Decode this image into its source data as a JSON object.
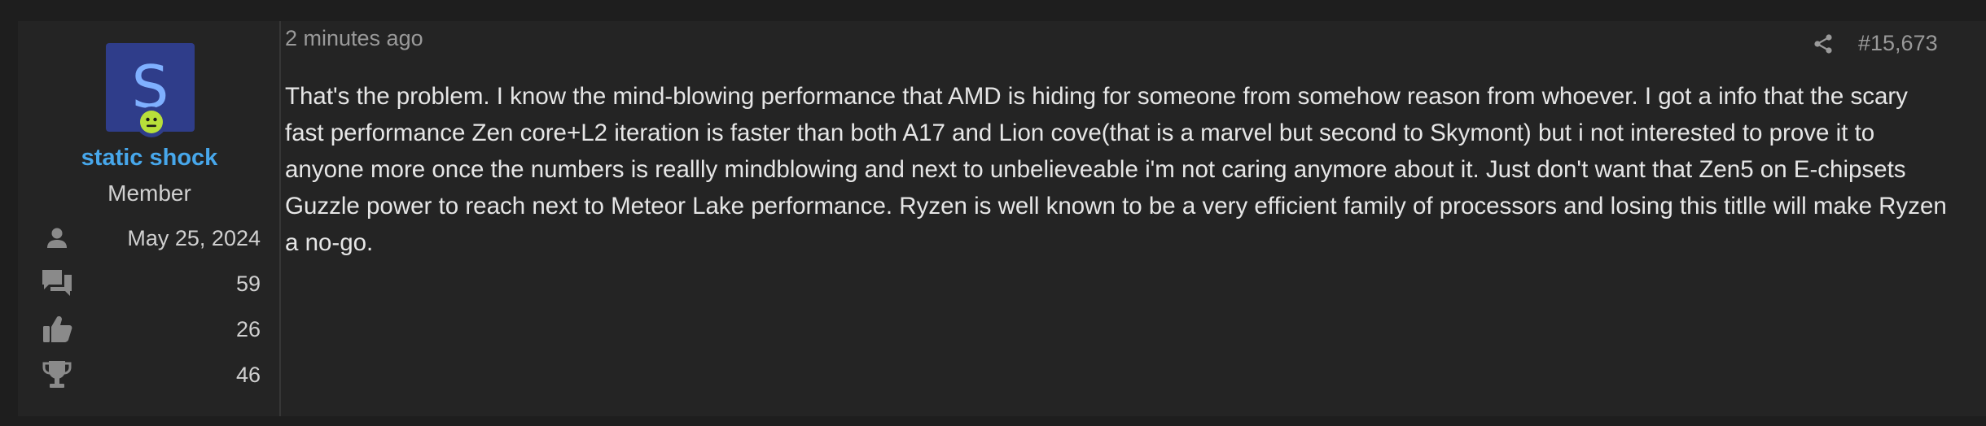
{
  "user": {
    "avatar_letter": "S",
    "status_icon": "smiley-status-icon",
    "name": "static shock",
    "title": "Member",
    "stats": [
      {
        "icon": "user-joined-icon",
        "value": "May 25, 2024"
      },
      {
        "icon": "messages-icon",
        "value": "59"
      },
      {
        "icon": "thumbs-up-icon",
        "value": "26"
      },
      {
        "icon": "trophy-icon",
        "value": "46"
      }
    ]
  },
  "post": {
    "time": "2 minutes ago",
    "share_icon": "share-icon",
    "number": "#15,673",
    "body": "That's the problem. I know the mind-blowing performance that AMD is hiding for someone from somehow reason from whoever. I got a info that the scary fast performance Zen core+L2 iteration is faster than both A17 and Lion cove(that is a marvel but second to Skymont) but i not interested to prove it to anyone more once the numbers is reallly mindblowing and next to unbelieveable i'm not caring anymore about it. Just don't want that Zen5 on E-chipsets Guzzle power to reach next to Meteor Lake performance. Ryzen is well known to be a very efficient family of processors and losing this titlle will make Ryzen a no-go."
  },
  "colors": {
    "page_bg": "#1e1e1e",
    "post_bg": "#242424",
    "username": "#47a7eb",
    "avatar_bg": "#2f3d8a",
    "status_green": "#b8e03a"
  }
}
